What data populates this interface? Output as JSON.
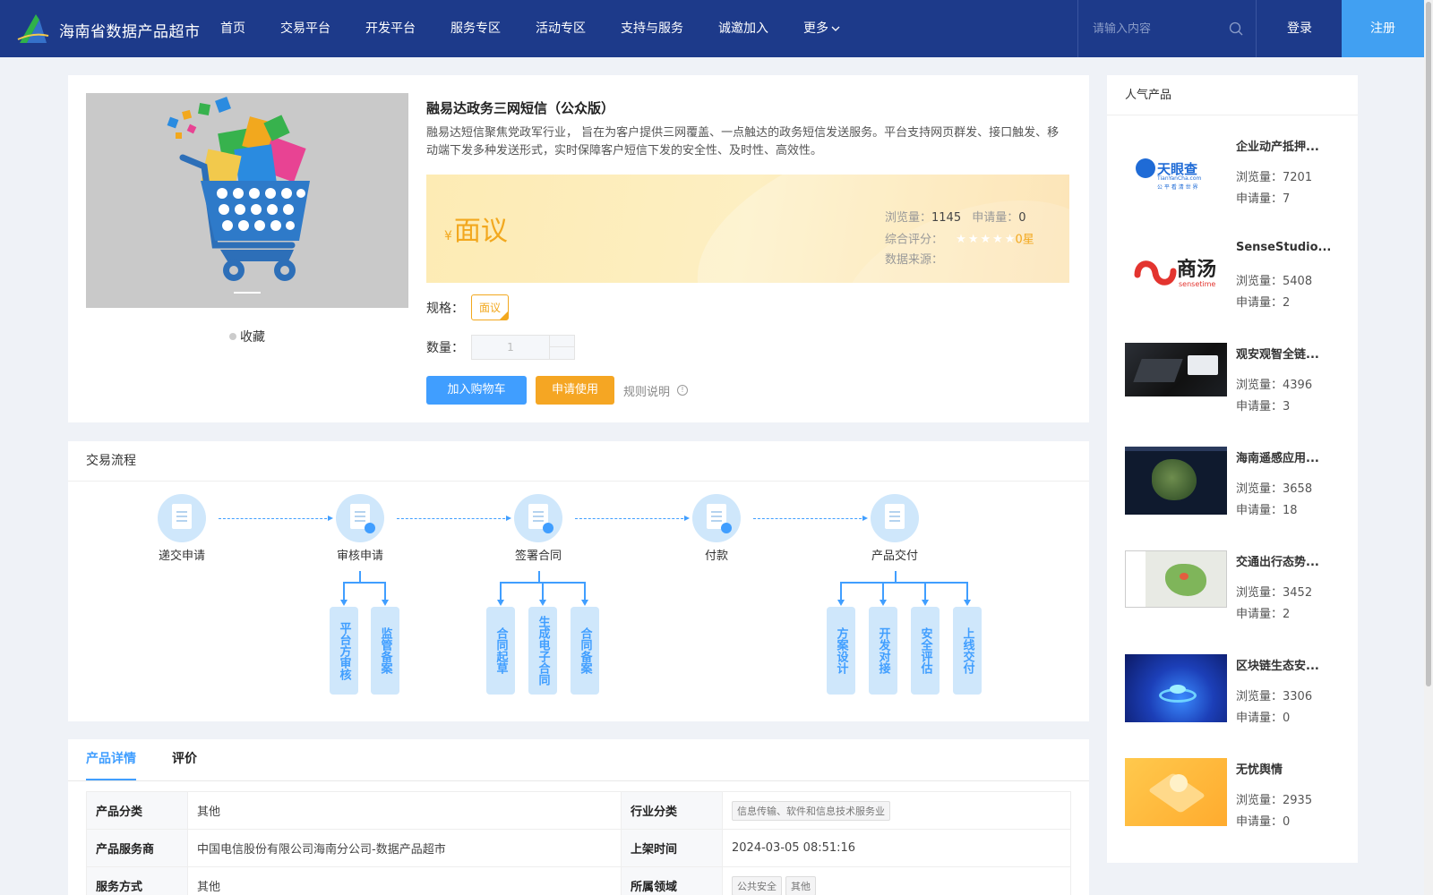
{
  "header": {
    "brand": "海南省数据产品超市",
    "nav": [
      "首页",
      "交易平台",
      "开发平台",
      "服务专区",
      "活动专区",
      "支持与服务",
      "诚邀加入",
      "更多"
    ],
    "search_placeholder": "请输入内容",
    "login": "登录",
    "register": "注册",
    "colors": {
      "bar": "#1d3a8a",
      "register": "#41a0f2"
    }
  },
  "product": {
    "favorite": "收藏",
    "title": "融易达政务三网短信（公众版）",
    "description": "融易达短信聚焦党政军行业， 旨在为客户提供三网覆盖、一点触达的政务短信发送服务。平台支持网页群发、接口触发、移动端下发多种发送形式，实时保障客户短信下发的安全性、及时性、高效性。",
    "price_symbol": "¥",
    "price": "面议",
    "views_label": "浏览量：",
    "views": "1145",
    "apply_label": "申请量：",
    "apply": "0",
    "score_label": "综合评分：",
    "score": "0星",
    "rating_stars": 0,
    "source_label": "数据来源：",
    "spec_label": "规格：",
    "spec_value": "面议",
    "qty_label": "数量：",
    "qty_value": "1",
    "add_cart": "加入购物车",
    "apply_use": "申请使用",
    "rules": "规则说明"
  },
  "process": {
    "title": "交易流程",
    "steps": [
      "递交申请",
      "审核申请",
      "签署合同",
      "付款",
      "产品交付"
    ],
    "sub_steps": {
      "review": [
        "平台方审核",
        "监管备案"
      ],
      "contract": [
        "合同起草",
        "生成电子合同",
        "合同备案"
      ],
      "delivery": [
        "方案设计",
        "开发对接",
        "安全评估",
        "上线交付"
      ]
    },
    "accent_color": "#409eff"
  },
  "details": {
    "tabs": [
      "产品详情",
      "评价"
    ],
    "rows": [
      {
        "l1": "产品分类",
        "v1": "其他",
        "l2": "行业分类",
        "tags": [
          "信息传输、软件和信息技术服务业"
        ]
      },
      {
        "l1": "产品服务商",
        "v1": "中国电信股份有限公司海南分公司-数据产品超市",
        "l2": "上架时间",
        "v2": "2024-03-05 08:51:16"
      },
      {
        "l1": "服务方式",
        "v1": "其他",
        "l2": "所属领域",
        "tags": [
          "公共安全",
          "其他"
        ]
      }
    ]
  },
  "popular": {
    "title": "人气产品",
    "items": [
      {
        "name": "企业动产抵押...",
        "views_label": "浏览量：",
        "views": "7201",
        "apply_label": "申请量：",
        "apply": "7",
        "logo_text": "天眼查",
        "logo_sub": "TianYanCha.com",
        "logo_tagline": "公 平 看 清 世 界"
      },
      {
        "name": "SenseStudio...",
        "views_label": "浏览量：",
        "views": "5408",
        "apply_label": "申请量：",
        "apply": "2",
        "logo_text": "商汤",
        "logo_sub": "sensetime"
      },
      {
        "name": "观安观智全链...",
        "views_label": "浏览量：",
        "views": "4396",
        "apply_label": "申请量：",
        "apply": "3"
      },
      {
        "name": "海南遥感应用...",
        "views_label": "浏览量：",
        "views": "3658",
        "apply_label": "申请量：",
        "apply": "18"
      },
      {
        "name": "交通出行态势...",
        "views_label": "浏览量：",
        "views": "3452",
        "apply_label": "申请量：",
        "apply": "2"
      },
      {
        "name": "区块链生态安...",
        "views_label": "浏览量：",
        "views": "3306",
        "apply_label": "申请量：",
        "apply": "0"
      },
      {
        "name": "无忧舆情",
        "views_label": "浏览量：",
        "views": "2935",
        "apply_label": "申请量：",
        "apply": "0"
      }
    ]
  }
}
